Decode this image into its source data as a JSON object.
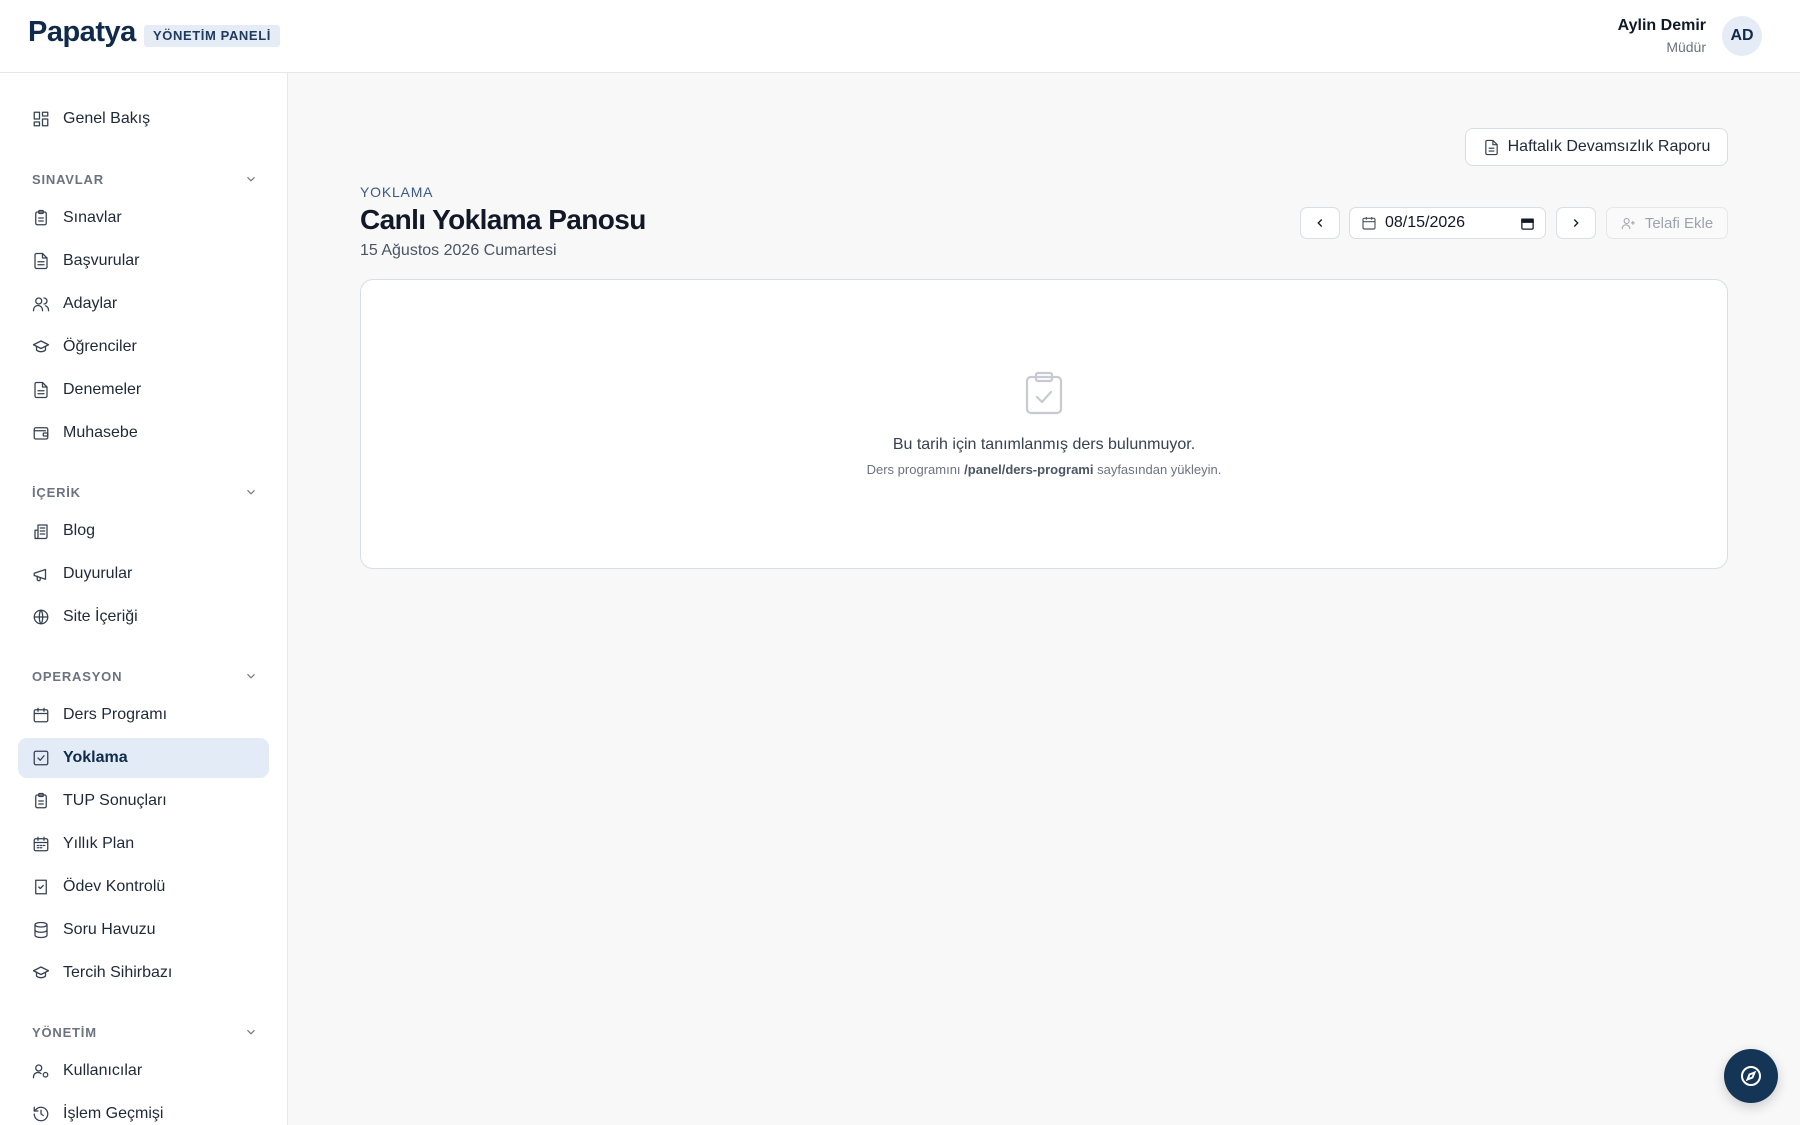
{
  "header": {
    "brand": "Papatya",
    "badge": "YÖNETİM PANELİ",
    "user_name": "Aylin Demir",
    "user_role": "Müdür",
    "avatar_initials": "AD"
  },
  "sidebar": {
    "top": [
      {
        "label": "Genel Bakış",
        "icon": "grid-icon"
      }
    ],
    "sections": [
      {
        "title": "SINAVLAR",
        "items": [
          {
            "label": "Sınavlar",
            "icon": "clipboard-icon"
          },
          {
            "label": "Başvurular",
            "icon": "file-icon"
          },
          {
            "label": "Adaylar",
            "icon": "users-icon"
          },
          {
            "label": "Öğrenciler",
            "icon": "graduation-cap-icon"
          },
          {
            "label": "Denemeler",
            "icon": "file-icon"
          },
          {
            "label": "Muhasebe",
            "icon": "wallet-icon"
          }
        ]
      },
      {
        "title": "İÇERİK",
        "items": [
          {
            "label": "Blog",
            "icon": "newspaper-icon"
          },
          {
            "label": "Duyurular",
            "icon": "megaphone-icon"
          },
          {
            "label": "Site İçeriği",
            "icon": "globe-icon"
          }
        ]
      },
      {
        "title": "OPERASYON",
        "items": [
          {
            "label": "Ders Programı",
            "icon": "calendar-icon"
          },
          {
            "label": "Yoklama",
            "icon": "check-square-icon",
            "active": true
          },
          {
            "label": "TUP Sonuçları",
            "icon": "clipboard-icon"
          },
          {
            "label": "Yıllık Plan",
            "icon": "calendar-days-icon"
          },
          {
            "label": "Ödev Kontrolü",
            "icon": "book-check-icon"
          },
          {
            "label": "Soru Havuzu",
            "icon": "database-icon"
          },
          {
            "label": "Tercih Sihirbazı",
            "icon": "graduation-cap-icon"
          }
        ]
      },
      {
        "title": "YÖNETİM",
        "items": [
          {
            "label": "Kullanıcılar",
            "icon": "user-cog-icon"
          },
          {
            "label": "İşlem Geçmişi",
            "icon": "history-icon"
          }
        ]
      }
    ]
  },
  "main": {
    "report_button": "Haftalık Devamsızlık Raporu",
    "eyebrow": "YOKLAMA",
    "title": "Canlı Yoklama Panosu",
    "subtitle": "15 Ağustos 2026 Cumartesi",
    "date_value": "08/15/2026",
    "telafi_button": "Telafi Ekle",
    "empty_title": "Bu tarih için tanımlanmış ders bulunmuyor.",
    "empty_desc_prefix": "Ders programını",
    "empty_desc_path": "/panel/ders-programi",
    "empty_desc_suffix": "sayfasından yükleyin."
  },
  "colors": {
    "brand": "#0f2a4a",
    "active_bg": "#e3ebf6",
    "fab": "#143556"
  }
}
